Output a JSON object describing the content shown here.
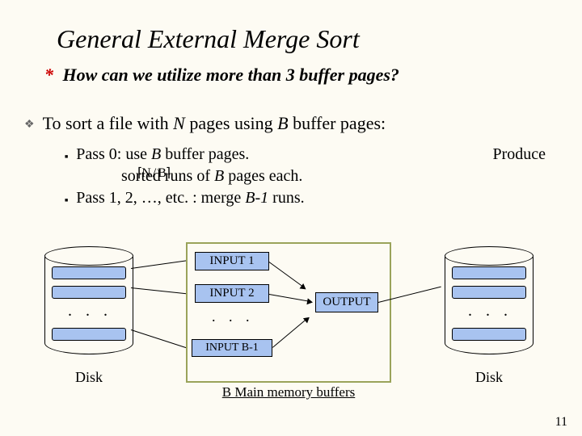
{
  "title": "General External Merge Sort",
  "question": "How can we utilize more than 3 buffer pages?",
  "main_bullet_pre": "To sort a file with ",
  "main_bullet_mid1": " pages using ",
  "main_bullet_post": " buffer pages:",
  "var_N": "N",
  "var_B": "B",
  "sub1_a": "Pass 0: use ",
  "sub1_b": " buffer pages.",
  "produce": "Produce",
  "sub1_line2_a": "sorted runs of ",
  "sub1_line2_b": " pages each.",
  "ceil_expr": "⌈N / B⌉",
  "sub2_a": "Pass 1, 2, …,  etc. : merge ",
  "sub2_b": "B-1",
  "sub2_c": " runs.",
  "diagram": {
    "input1": "INPUT 1",
    "input2": "INPUT 2",
    "inputB": "INPUT B-1",
    "output": "OUTPUT",
    "dots": ". . .",
    "disk": "Disk",
    "mem_caption": "B Main memory buffers"
  },
  "page_number": "11"
}
